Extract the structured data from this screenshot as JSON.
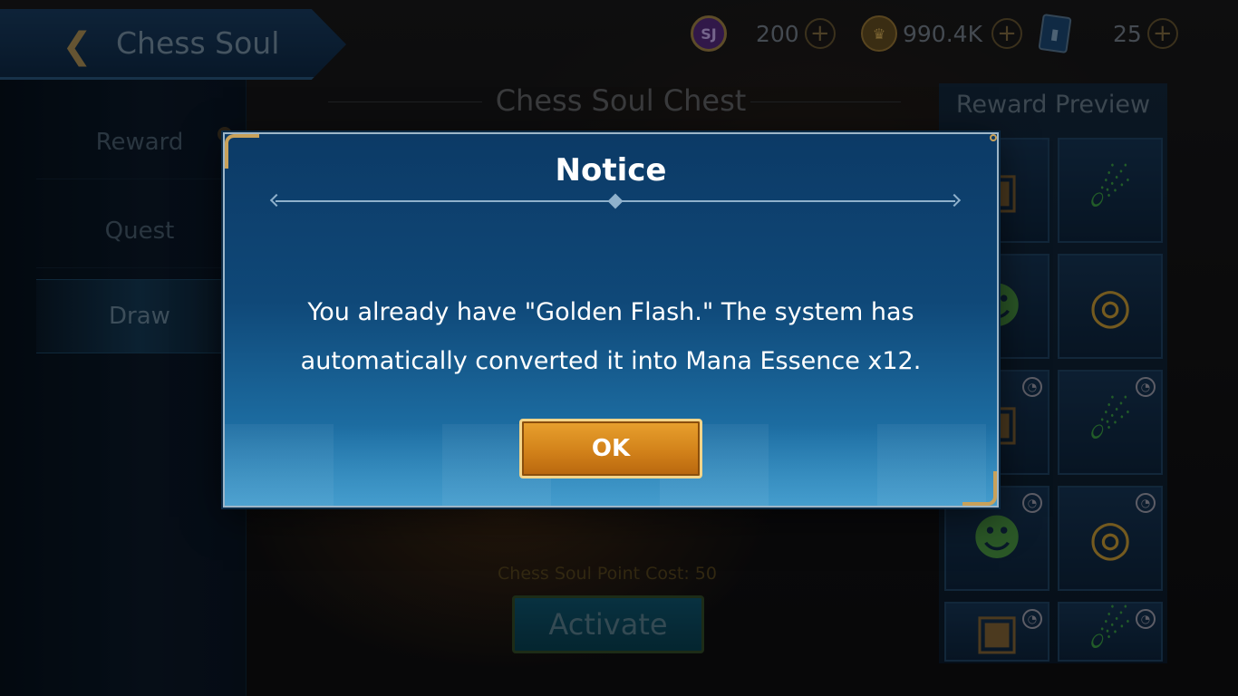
{
  "header": {
    "title": "Chess Soul",
    "back_icon": "chevron-left-icon"
  },
  "currency": [
    {
      "icon": "soul-coin-icon",
      "icon_text": "SJ",
      "value": "200",
      "color": "#7a3fb0"
    },
    {
      "icon": "crown-coin-icon",
      "icon_text": "♛",
      "value": "990.4K",
      "color": "#c99a3a"
    },
    {
      "icon": "ticket-icon",
      "icon_text": "▮",
      "value": "25",
      "color": "#2b6aa8"
    }
  ],
  "sidebar": {
    "items": [
      {
        "label": "Reward"
      },
      {
        "label": "Quest"
      },
      {
        "label": "Draw",
        "active": true
      }
    ]
  },
  "main": {
    "chest_title": "Chess Soul Chest",
    "cost_text": "Chess Soul Point Cost: 50",
    "activate_label": "Activate"
  },
  "reward_preview": {
    "title": "Reward Preview",
    "items": [
      {
        "icon": "treasure-chest-icon",
        "glyph": "▣",
        "timed": false
      },
      {
        "icon": "green-comet-icon",
        "glyph": "☄",
        "timed": false
      },
      {
        "icon": "green-frog-icon",
        "glyph": "☻",
        "timed": false
      },
      {
        "icon": "golden-ring-icon",
        "glyph": "◎",
        "timed": false
      },
      {
        "icon": "treasure-chest-icon",
        "glyph": "▣",
        "timed": true
      },
      {
        "icon": "green-comet-icon",
        "glyph": "☄",
        "timed": true
      },
      {
        "icon": "green-frog-icon",
        "glyph": "☻",
        "timed": true
      },
      {
        "icon": "golden-ring-icon",
        "glyph": "◎",
        "timed": true
      },
      {
        "icon": "treasure-chest-icon",
        "glyph": "▣",
        "timed": true
      },
      {
        "icon": "green-comet-icon",
        "glyph": "☄",
        "timed": true
      }
    ]
  },
  "modal": {
    "title": "Notice",
    "message_line1": "You already have \"Golden Flash.\" The system has",
    "message_line2": "automatically converted it into Mana Essence x12.",
    "ok_label": "OK"
  },
  "colors": {
    "accent_gold": "#c8a15a",
    "modal_blue": "#0f4878",
    "ok_orange": "#d2821a"
  }
}
